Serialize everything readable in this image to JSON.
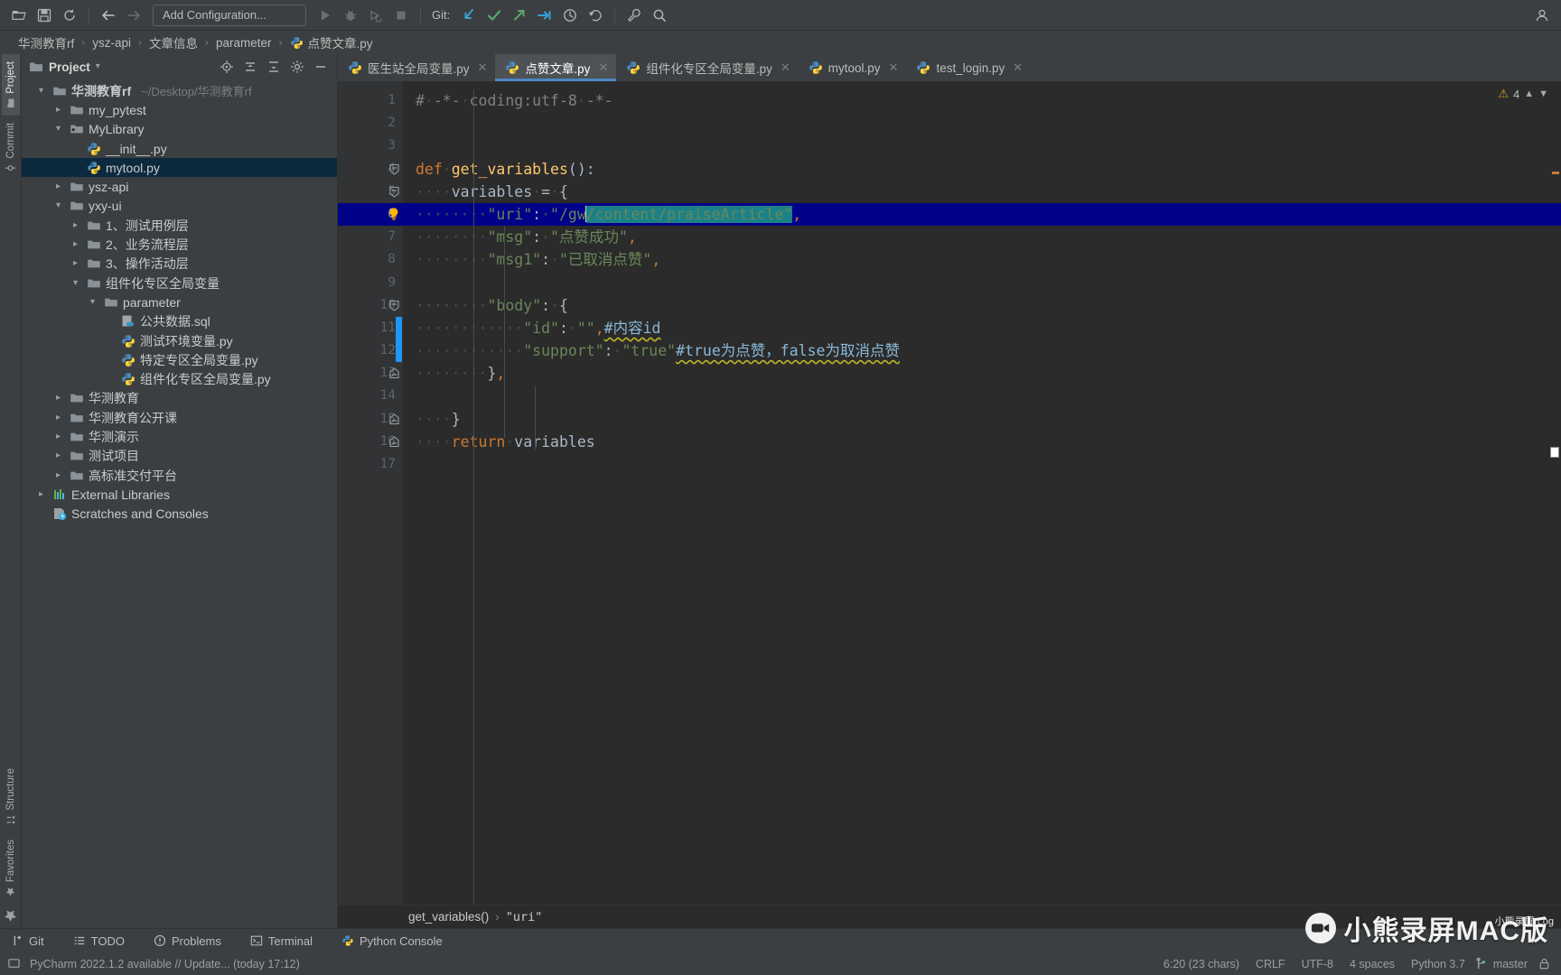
{
  "toolbar": {
    "icons": [
      "open-folder-icon",
      "save-icon",
      "sync-icon",
      "back-arrow-icon",
      "forward-arrow-icon"
    ],
    "run_config_label": "Add Configuration...",
    "run_icons": [
      "run-icon",
      "debug-icon",
      "coverage-icon",
      "stop-icon"
    ],
    "git_label": "Git:",
    "git_icons": [
      "update-project-icon",
      "commit-icon",
      "push-icon",
      "pull-request-icon",
      "history-icon",
      "rollback-icon"
    ],
    "right_icons": [
      "wrench-icon",
      "search-icon"
    ]
  },
  "breadcrumb": {
    "items": [
      "华测教育rf",
      "ysz-api",
      "文章信息",
      "parameter"
    ],
    "file": "点赞文章.py",
    "separator": "›"
  },
  "left_strip": {
    "top": [
      {
        "label": "Project",
        "icon": "project-folder-icon",
        "active": true
      },
      {
        "label": "Commit",
        "icon": "commit-icon",
        "active": false
      }
    ],
    "bottom": [
      {
        "label": "Structure",
        "icon": "structure-icon"
      },
      {
        "label": "Favorites",
        "icon": "star-icon"
      }
    ]
  },
  "project_panel": {
    "title": "Project",
    "dropdown_icon": "chevron-down-icon",
    "header_icons": [
      "locate-icon",
      "collapse-all-icon",
      "expand-icon",
      "gear-icon",
      "minimize-icon"
    ],
    "tree": [
      {
        "depth": 0,
        "twisty": "down",
        "icon": "folder",
        "label": "华测教育rf",
        "path": "~/Desktop/华测教育rf",
        "bold": true
      },
      {
        "depth": 1,
        "twisty": "right",
        "icon": "folder",
        "label": "my_pytest"
      },
      {
        "depth": 1,
        "twisty": "down",
        "icon": "module",
        "label": "MyLibrary"
      },
      {
        "depth": 2,
        "twisty": "none",
        "icon": "python",
        "label": "__init__.py"
      },
      {
        "depth": 2,
        "twisty": "none",
        "icon": "python",
        "label": "mytool.py",
        "selected": true
      },
      {
        "depth": 1,
        "twisty": "right",
        "icon": "folder",
        "label": "ysz-api"
      },
      {
        "depth": 1,
        "twisty": "down",
        "icon": "folder",
        "label": "yxy-ui"
      },
      {
        "depth": 2,
        "twisty": "right",
        "icon": "folder",
        "label": "1、测试用例层"
      },
      {
        "depth": 2,
        "twisty": "right",
        "icon": "folder",
        "label": "2、业务流程层"
      },
      {
        "depth": 2,
        "twisty": "right",
        "icon": "folder",
        "label": "3、操作活动层"
      },
      {
        "depth": 2,
        "twisty": "down",
        "icon": "folder",
        "label": "组件化专区全局变量"
      },
      {
        "depth": 3,
        "twisty": "down",
        "icon": "folder",
        "label": "parameter"
      },
      {
        "depth": 4,
        "twisty": "none",
        "icon": "sql",
        "label": "公共数据.sql"
      },
      {
        "depth": 4,
        "twisty": "none",
        "icon": "python",
        "label": "测试环境变量.py"
      },
      {
        "depth": 4,
        "twisty": "none",
        "icon": "python",
        "label": "特定专区全局变量.py"
      },
      {
        "depth": 4,
        "twisty": "none",
        "icon": "python",
        "label": "组件化专区全局变量.py"
      },
      {
        "depth": 1,
        "twisty": "right",
        "icon": "folder",
        "label": "华测教育"
      },
      {
        "depth": 1,
        "twisty": "right",
        "icon": "folder",
        "label": "华测教育公开课"
      },
      {
        "depth": 1,
        "twisty": "right",
        "icon": "folder",
        "label": "华测演示"
      },
      {
        "depth": 1,
        "twisty": "right",
        "icon": "folder",
        "label": "测试项目"
      },
      {
        "depth": 1,
        "twisty": "right",
        "icon": "folder",
        "label": "高标准交付平台"
      },
      {
        "depth": 0,
        "twisty": "right",
        "icon": "library",
        "label": "External Libraries"
      },
      {
        "depth": 0,
        "twisty": "none",
        "icon": "scratch",
        "label": "Scratches and Consoles"
      }
    ]
  },
  "editor_tabs": [
    {
      "label": "医生站全局变量.py",
      "icon": "python-file-icon",
      "active": false
    },
    {
      "label": "点赞文章.py",
      "icon": "python-file-icon",
      "active": true
    },
    {
      "label": "组件化专区全局变量.py",
      "icon": "python-file-icon",
      "active": false
    },
    {
      "label": "mytool.py",
      "icon": "python-file-icon",
      "active": false
    },
    {
      "label": "test_login.py",
      "icon": "python-file-icon",
      "active": false
    }
  ],
  "editor": {
    "current_line": 6,
    "line_numbers": [
      "1",
      "2",
      "3",
      "4",
      "5",
      "6",
      "7",
      "8",
      "9",
      "10",
      "11",
      "12",
      "13",
      "14",
      "15",
      "16",
      "17"
    ],
    "lines": [
      "# -*- coding:utf-8 -*-",
      "",
      "",
      "def get_variables():",
      "    variables = {",
      "        \"uri\": \"/gw/content/praiseArticle\",",
      "        \"msg\": \"点赞成功\",",
      "        \"msg1\": \"已取消点赞\",",
      "",
      "        \"body\": {",
      "            \"id\": \"\",#内容id",
      "            \"support\": \"true\"#true为点赞，false为取消点赞",
      "        },",
      "",
      "    }",
      "    return variables",
      ""
    ],
    "inspection": {
      "count": "4",
      "warn_icon": "warning-triangle-icon",
      "up_icon": "chevron-up-icon",
      "down_icon": "chevron-down-icon"
    },
    "breadcrumb": {
      "func": "get_variables()",
      "member": "\"uri\"",
      "sep": "›"
    }
  },
  "tool_window_bar": [
    {
      "label": "Git",
      "icon": "git-branch-icon"
    },
    {
      "label": "TODO",
      "icon": "todo-list-icon"
    },
    {
      "label": "Problems",
      "icon": "problems-icon"
    },
    {
      "label": "Terminal",
      "icon": "terminal-icon"
    },
    {
      "label": "Python Console",
      "icon": "python-console-icon"
    }
  ],
  "status_bar": {
    "message": "PyCharm 2022.1.2 available // Update... (today 17:12)",
    "message_icon": "ide-update-icon",
    "caret": "6:20 (23 chars)",
    "line_separator": "CRLF",
    "encoding": "UTF-8",
    "indent": "4 spaces",
    "interpreter": "Python 3.7",
    "branch": "master",
    "branch_icon": "git-branch-icon",
    "lock_icon": "lock-icon"
  },
  "watermark": {
    "text": "小熊录屏MAC版",
    "icon": "video-camera-icon",
    "superscript": "小熊录屏 Log"
  },
  "colors": {
    "accent_blue": "#4a88c7",
    "selection_blue": "#000088",
    "found_teal": "#1a8188",
    "string_green": "#6a8759",
    "keyword_orange": "#cc7832",
    "function_yellow": "#ffc66d",
    "comment_gray": "#808080",
    "editor_bg": "#2b2b2b",
    "panel_bg": "#3c3f41",
    "gutter_bg": "#313335",
    "tree_selected": "#0d293e"
  }
}
